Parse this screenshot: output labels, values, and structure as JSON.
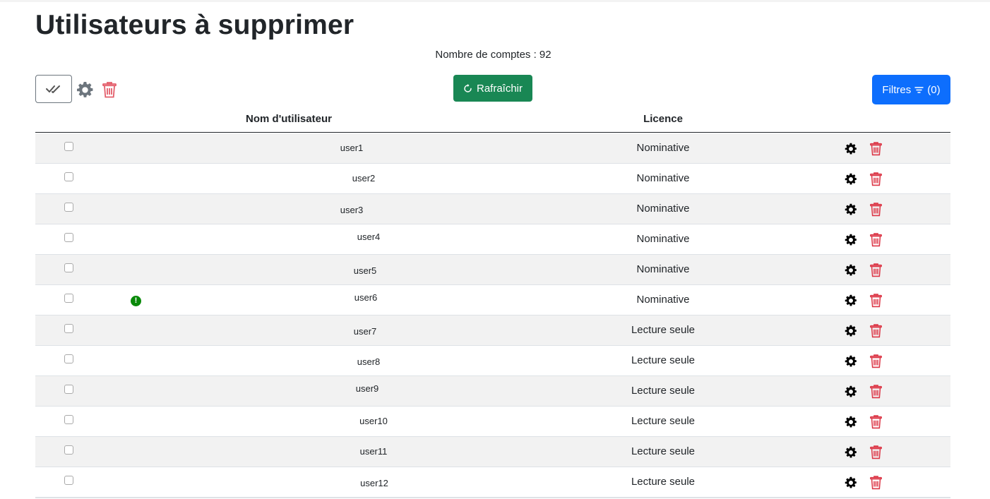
{
  "page": {
    "title": "Utilisateurs à supprimer",
    "count_label": "Nombre de comptes : 92"
  },
  "toolbar": {
    "refresh_label": "Rafraîchir",
    "filters_label": "Filtres",
    "filters_count": "(0)"
  },
  "table": {
    "headers": {
      "username": "Nom d'utilisateur",
      "license": "Licence"
    },
    "rows": [
      {
        "username": "user1",
        "license": "Nominative",
        "warning": false
      },
      {
        "username": "user2",
        "license": "Nominative",
        "warning": false
      },
      {
        "username": "user3",
        "license": "Nominative",
        "warning": false
      },
      {
        "username": "user4",
        "license": "Nominative",
        "warning": false
      },
      {
        "username": "user5",
        "license": "Nominative",
        "warning": false
      },
      {
        "username": "user6",
        "license": "Nominative",
        "warning": true
      },
      {
        "username": "user7",
        "license": "Lecture seule",
        "warning": false
      },
      {
        "username": "user8",
        "license": "Lecture seule",
        "warning": false
      },
      {
        "username": "user9",
        "license": "Lecture seule",
        "warning": false
      },
      {
        "username": "user10",
        "license": "Lecture seule",
        "warning": false
      },
      {
        "username": "user11",
        "license": "Lecture seule",
        "warning": false
      },
      {
        "username": "user12",
        "license": "Lecture seule",
        "warning": false
      }
    ]
  },
  "colors": {
    "refresh_button": "#198754",
    "filters_button": "#0d6efd",
    "delete_icon": "#dc3545",
    "warning_badge": "#0a8a0a",
    "striped_row": "#f2f2f2"
  },
  "icons": {
    "select_all": "double-check-icon",
    "toolbar_settings": "gear-icon",
    "toolbar_delete": "trash-icon",
    "refresh": "refresh-icon",
    "filters": "filter-icon",
    "row_settings": "gear-icon",
    "row_delete": "trash-icon",
    "warning": "exclamation-circle-icon"
  }
}
